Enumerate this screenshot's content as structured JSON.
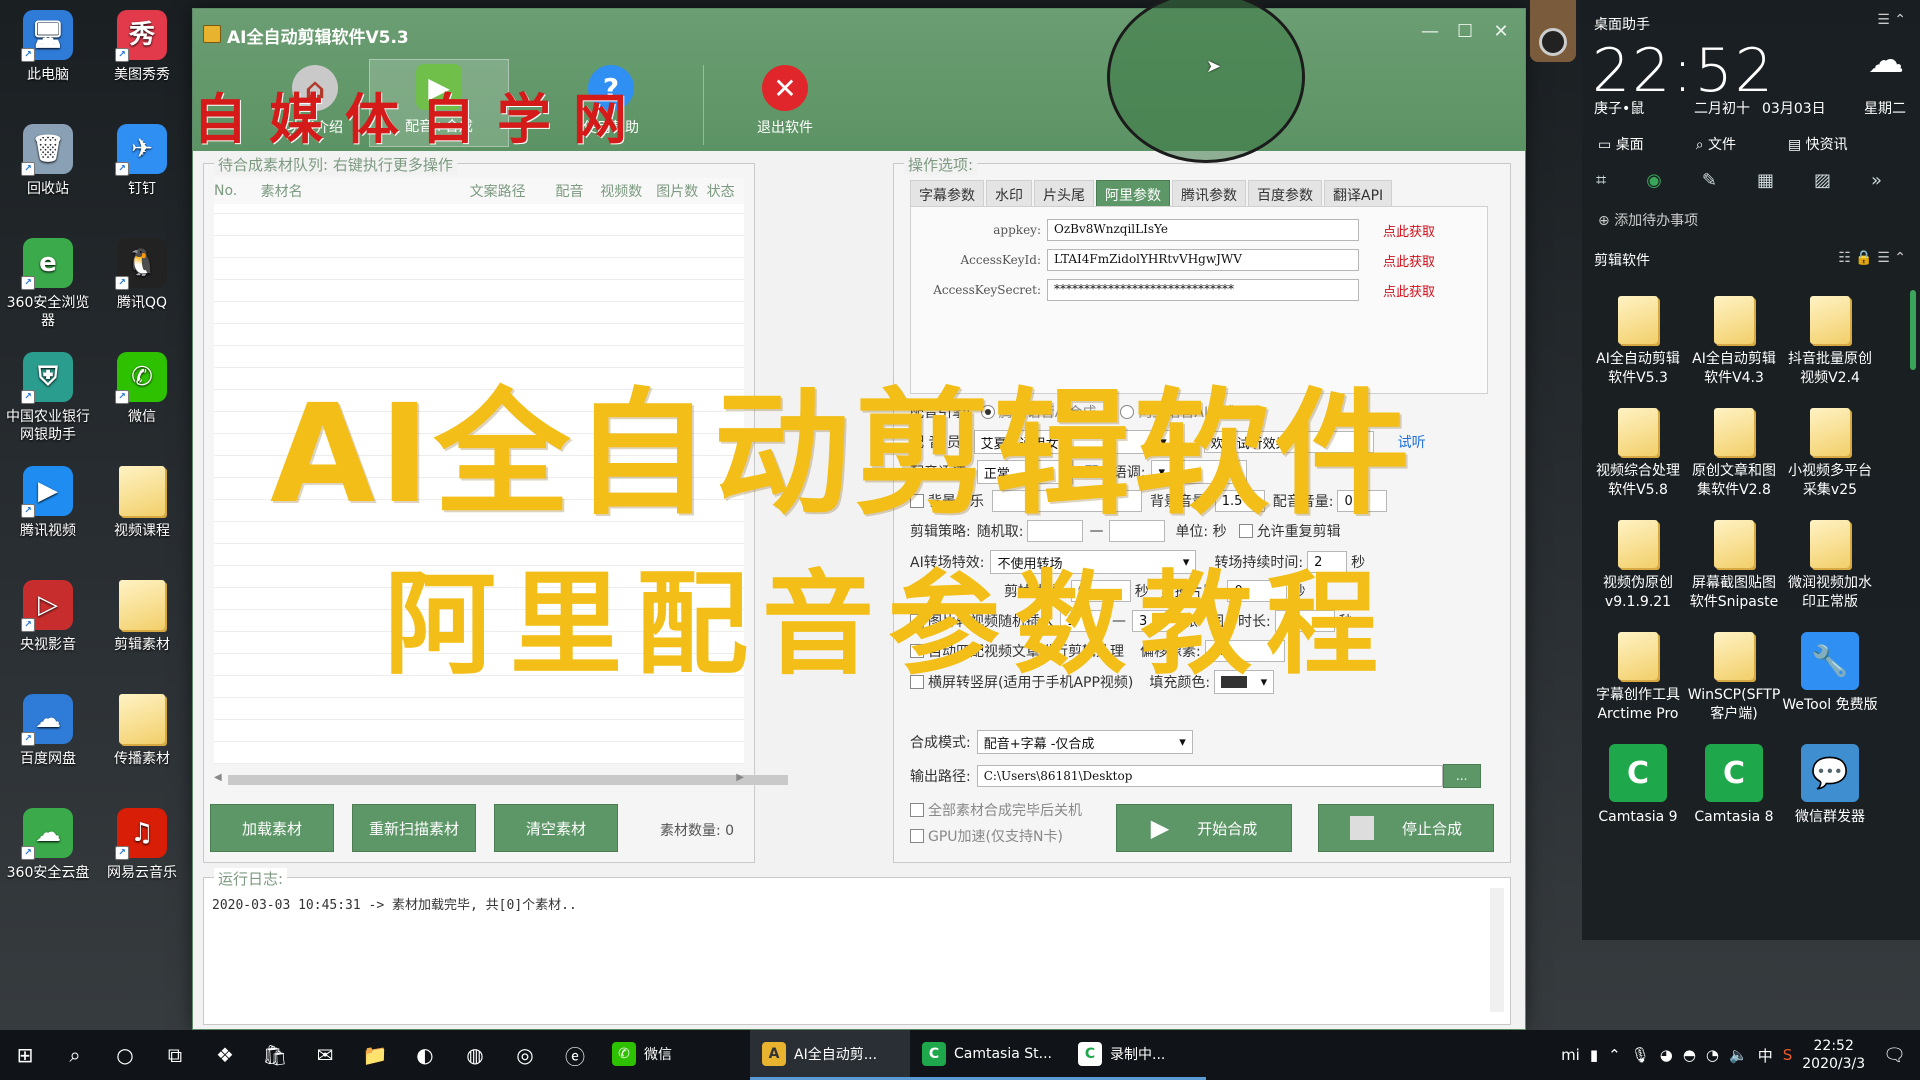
{
  "desktop_icons": [
    {
      "label": "此电脑",
      "icon": "computer-icon",
      "color": "#2f7bd8"
    },
    {
      "label": "美图秀秀",
      "icon": "meitu-icon",
      "color": "#e23a4b"
    },
    {
      "label": "回收站",
      "icon": "recycle-bin-icon",
      "color": "#8aa0b4"
    },
    {
      "label": "钉钉",
      "icon": "dingtalk-icon",
      "color": "#2f8ff3"
    },
    {
      "label": "360安全浏览器",
      "icon": "browser-360-icon",
      "color": "#3aaa4a"
    },
    {
      "label": "腾讯QQ",
      "icon": "qq-icon",
      "color": "#222222"
    },
    {
      "label": "中国农业银行网银助手",
      "icon": "abc-bank-icon",
      "color": "#2a9d8f"
    },
    {
      "label": "微信",
      "icon": "wechat-icon",
      "color": "#2dc100"
    },
    {
      "label": "腾讯视频",
      "icon": "tencent-video-icon",
      "color": "#1e8cf0"
    },
    {
      "label": "视频课程",
      "icon": "folder-icon",
      "color": "#f2cf6a"
    },
    {
      "label": "央视影音",
      "icon": "cctv-video-icon",
      "color": "#c82d2d"
    },
    {
      "label": "剪辑素材",
      "icon": "folder-icon",
      "color": "#f2cf6a"
    },
    {
      "label": "百度网盘",
      "icon": "baidu-pan-icon",
      "color": "#2f7bd8"
    },
    {
      "label": "传播素材",
      "icon": "folder-icon",
      "color": "#f2cf6a"
    },
    {
      "label": "360安全云盘",
      "icon": "cloud-360-icon",
      "color": "#3aaa4a"
    },
    {
      "label": "网易云音乐",
      "icon": "netease-music-icon",
      "color": "#d81e06"
    }
  ],
  "window": {
    "title": "AI全自动剪辑软件V5.3",
    "toolbar": {
      "btn1": "功能介绍",
      "btn2": "配音+合成",
      "btn3": "使用帮助",
      "btn4": "退出软件"
    },
    "watermark": "自媒体自学网"
  },
  "queue": {
    "title": "待合成素材队列: 右键执行更多操作",
    "columns": [
      "No.",
      "素材名",
      "文案路径",
      "配音",
      "视频数",
      "图片数",
      "状态"
    ],
    "buttons": {
      "load": "加载素材",
      "rescan": "重新扫描素材",
      "clear": "清空素材"
    },
    "count_label": "素材数量: 0"
  },
  "options": {
    "title": "操作选项:",
    "tabs": [
      "字幕参数",
      "水印",
      "片头尾",
      "阿里参数",
      "腾讯参数",
      "百度参数",
      "翻译API"
    ],
    "active_tab": "阿里参数",
    "params": [
      {
        "label": "appkey:",
        "value": "OzBv8WnzqilLIsYe",
        "link": "点此获取"
      },
      {
        "label": "AccessKeyId:",
        "value": "LTAI4FmZidolYHRtvVHgwJWV",
        "link": "点此获取"
      },
      {
        "label": "AccessKeySecret:",
        "value": "******************************",
        "link": "点此获取"
      }
    ],
    "engine_label": "配音引擎:",
    "engine_opt1": "腾讯语音AI合成",
    "engine_opt2": "阿里语音AI合成",
    "voice_label": "配 音 员:",
    "voice_value": "艾夏 - 通用女声",
    "voice_trial": "欢迎试听效果",
    "voice_link": "试听",
    "speed_label": "配音语速:",
    "speed_value": "正常",
    "tone_label": "配音语调:",
    "bgm_label": "背景音乐",
    "bgm_vol_label": "背景音量:",
    "bgm_vol_value": "1.5",
    "voice_vol_label": "配音音量:",
    "voice_vol_value": "0.2",
    "clip_label": "剪辑策略:",
    "clip_random": "随机取:",
    "clip_dash": "—",
    "clip_unit": "单位: 秒",
    "clip_repeat": "允许重复剪辑",
    "transition_label": "AI转场特效:",
    "transition_value": "不使用转场",
    "transition_time_label": "转场持续时间:",
    "transition_time_value": "2",
    "transition_unit": "秒",
    "cut_head_label": "剪掉片头:",
    "cut_head_value": "0",
    "cut_head_unit": "秒",
    "cut_tail_label": "剪掉片尾:",
    "cut_tail_value": "0",
    "cut_tail_unit": "秒",
    "img_insert_label": "图片转视频随机插入",
    "img_insert_a": "1",
    "img_insert_b": "3",
    "img_insert_unit": "张",
    "img_duration_label": "图片时长:",
    "img_duration_unit": "秒",
    "auto_match_label": "自动匹配视频文章进行剪辑处理",
    "offset_label": "偏移像素:",
    "offset_value": "15",
    "portrait_label": "横屏转竖屏(适用于手机APP视频)",
    "fill_color_label": "填充颜色:",
    "mode_label": "合成模式:",
    "mode_value": "配音+字幕 -仅合成",
    "output_label": "输出路径:",
    "output_value": "C:\\Users\\86181\\Desktop",
    "output_btn": "...",
    "shutdown_label": "全部素材合成完毕后关机",
    "gpu_label": "GPU加速(仅支持N卡)",
    "start_btn": "开始合成",
    "stop_btn": "停止合成"
  },
  "log": {
    "title": "运行日志:",
    "line": "2020-03-03 10:45:31 -> 素材加载完毕, 共[0]个素材.."
  },
  "overlay": {
    "line1": "AI全自动剪辑软件",
    "line2": "阿里配音参数教程"
  },
  "widget": {
    "title": "桌面助手",
    "time": "22:52",
    "sub1": "庚子•鼠",
    "sub2": "二月初十",
    "sub3": "03月03日",
    "sub4": "星期二",
    "nav1": "桌面",
    "nav2": "文件",
    "nav3": "快资讯",
    "add_todo": "添加待办事项",
    "section": "剪辑软件",
    "items": [
      {
        "label": "AI全自动剪辑软件V5.3",
        "kind": "folder"
      },
      {
        "label": "AI全自动剪辑软件V4.3",
        "kind": "folder"
      },
      {
        "label": "抖音批量原创视频V2.4",
        "kind": "folder"
      },
      {
        "label": "视频综合处理软件V5.8",
        "kind": "folder"
      },
      {
        "label": "原创文章和图集软件V2.8",
        "kind": "folder"
      },
      {
        "label": "小视频多平台采集v25",
        "kind": "folder"
      },
      {
        "label": "视频伪原创v9.1.9.21",
        "kind": "folder"
      },
      {
        "label": "屏幕截图贴图软件Snipaste",
        "kind": "folder"
      },
      {
        "label": "微润视频加水印正常版",
        "kind": "folder"
      },
      {
        "label": "字幕创作工具Arctime Pro",
        "kind": "folder"
      },
      {
        "label": "WinSCP(SFTP客户端)",
        "kind": "folder"
      },
      {
        "label": "WeTool 免费版",
        "kind": "app",
        "color": "#2f8ff3",
        "glyph": "🔧"
      },
      {
        "label": "Camtasia 9",
        "kind": "app",
        "color": "#1ea84b",
        "glyph": "C"
      },
      {
        "label": "Camtasia 8",
        "kind": "app",
        "color": "#1ea84b",
        "glyph": "C"
      },
      {
        "label": "微信群发器",
        "kind": "app",
        "color": "#3e8ed0",
        "glyph": "💬"
      }
    ]
  },
  "taskbar": {
    "wechat": "微信",
    "task1": "AI全自动剪...",
    "task2": "Camtasia St...",
    "task3": "录制中...",
    "ime": "中",
    "time": "22:52",
    "date": "2020/3/3"
  }
}
